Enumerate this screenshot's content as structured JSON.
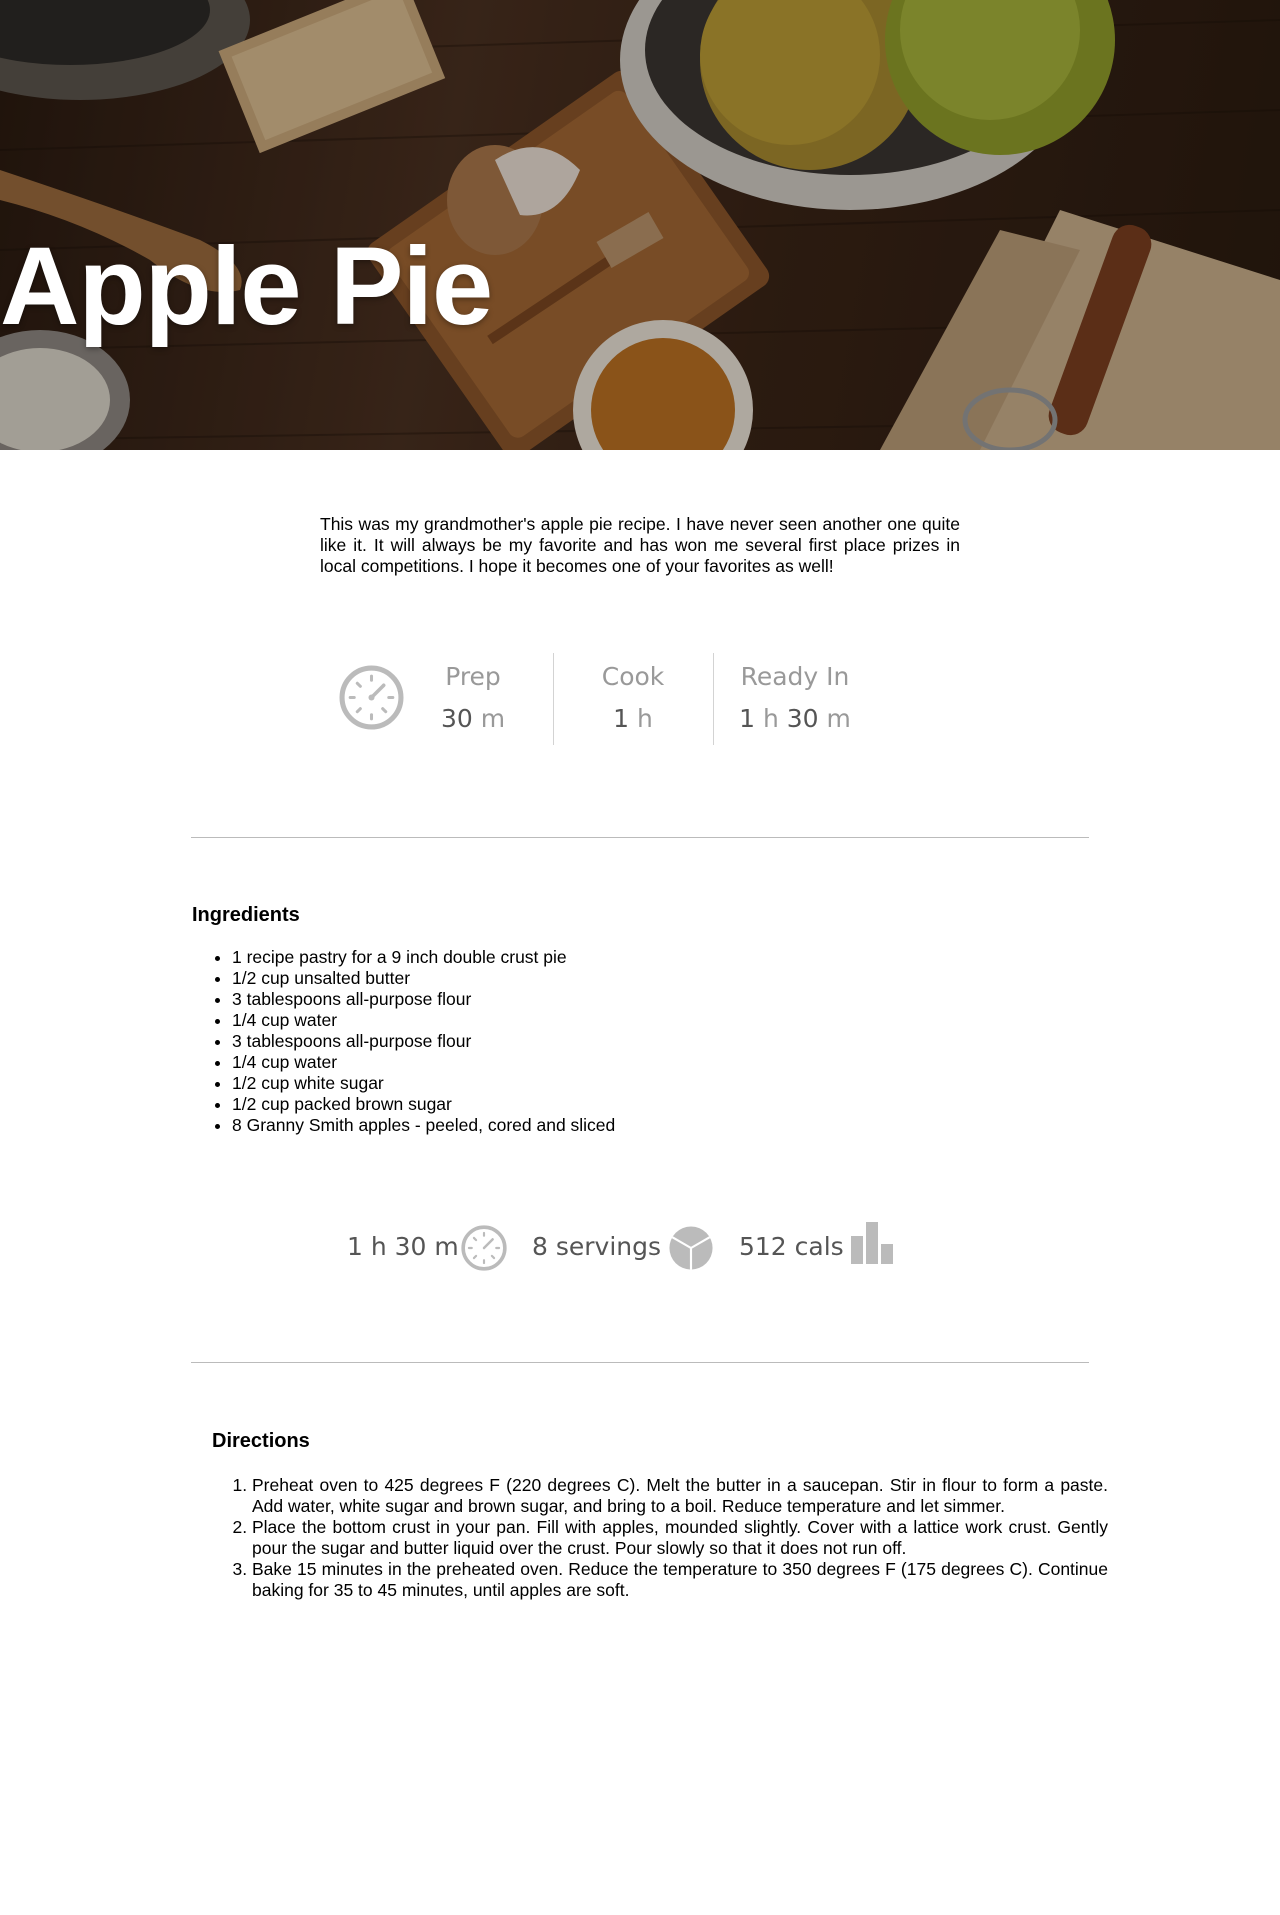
{
  "recipe": {
    "title": "Apple Pie",
    "intro": "This was my grandmother's apple pie recipe. I have never seen another one quite like it. It will always be my favorite and has won me several first place prizes in local competitions. I hope it becomes one of your favorites as well!"
  },
  "times": {
    "prep": {
      "label": "Prep",
      "value": [
        {
          "num": "30",
          "unit": "m"
        }
      ]
    },
    "cook": {
      "label": "Cook",
      "value": [
        {
          "num": "1",
          "unit": "h"
        }
      ]
    },
    "ready": {
      "label": "Ready In",
      "value": [
        {
          "num": "1",
          "unit": "h"
        },
        {
          "num": "30",
          "unit": "m"
        }
      ]
    }
  },
  "ingredients": {
    "title": "Ingredients",
    "items": [
      "1 recipe pastry for a 9 inch double crust pie",
      "1/2 cup unsalted butter",
      "3 tablespoons all-purpose flour",
      "1/4 cup water",
      "3 tablespoons all-purpose flour",
      "1/4 cup water",
      "1/2 cup white sugar",
      "1/2 cup packed brown sugar",
      "8 Granny Smith apples - peeled, cored and sliced"
    ]
  },
  "nutrition": {
    "total_time": "1 h 30 m",
    "servings": "8 servings",
    "calories": "512 cals",
    "icons": [
      "clock-icon",
      "pie-icon",
      "bar-chart-icon"
    ]
  },
  "directions": {
    "title": "Directions",
    "steps": [
      "Preheat oven to 425 degrees F (220 degrees C). Melt the butter in a saucepan. Stir in flour to form a paste. Add water, white sugar and brown sugar, and bring to a boil. Reduce temperature and let simmer.",
      "Place the bottom crust in your pan. Fill with apples, mounded slightly. Cover with a lattice work crust. Gently pour the sugar and butter liquid over the crust. Pour slowly so that it does not run off.",
      "Bake 15 minutes in the preheated oven. Reduce the temperature to 350 degrees F (175 degrees C). Continue baking for 35 to 45 minutes, until apples are soft."
    ]
  },
  "colors": {
    "icon_gray": "#bbbbbb",
    "muted_text": "#999999",
    "value_text": "#555555",
    "divider": "#bbbbbb"
  }
}
